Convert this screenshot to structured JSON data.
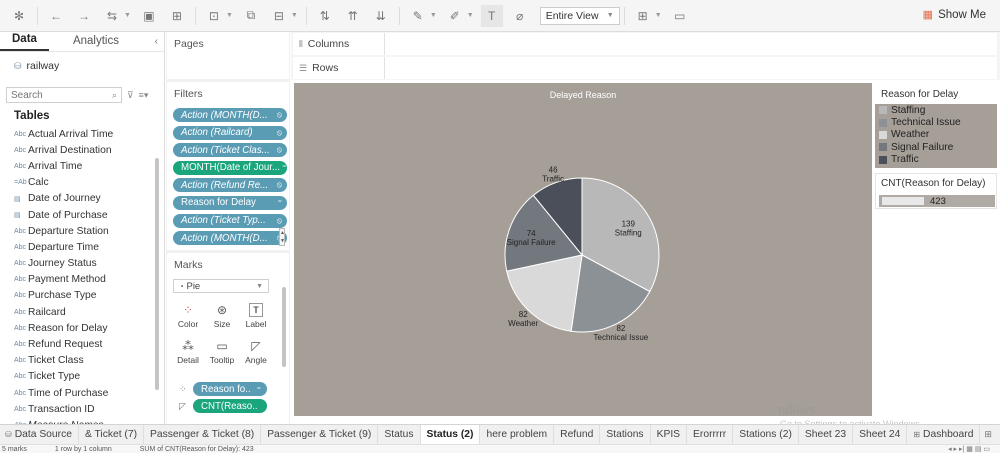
{
  "toolbar": {
    "fit_label": "Entire View",
    "show_me_label": "Show Me"
  },
  "data_pane": {
    "tabs": [
      "Data",
      "Analytics"
    ],
    "datasource": "railway",
    "search_placeholder": "Search",
    "tables_header": "Tables",
    "fields": [
      {
        "label": "Actual Arrival Time",
        "icon": "abc"
      },
      {
        "label": "Arrival Destination",
        "icon": "abc"
      },
      {
        "label": "Arrival Time",
        "icon": "abc"
      },
      {
        "label": "Calc",
        "icon": "=Abc"
      },
      {
        "label": "Date of Journey",
        "icon": "date"
      },
      {
        "label": "Date of Purchase",
        "icon": "date"
      },
      {
        "label": "Departure Station",
        "icon": "abc"
      },
      {
        "label": "Departure Time",
        "icon": "abc"
      },
      {
        "label": "Journey Status",
        "icon": "abc"
      },
      {
        "label": "Payment Method",
        "icon": "abc"
      },
      {
        "label": "Purchase Type",
        "icon": "abc"
      },
      {
        "label": "Railcard",
        "icon": "abc"
      },
      {
        "label": "Reason for Delay",
        "icon": "abc"
      },
      {
        "label": "Refund Request",
        "icon": "abc"
      },
      {
        "label": "Ticket Class",
        "icon": "abc"
      },
      {
        "label": "Ticket Type",
        "icon": "abc"
      },
      {
        "label": "Time of Purchase",
        "icon": "abc"
      },
      {
        "label": "Transaction ID",
        "icon": "abc"
      },
      {
        "label": "Measure Names",
        "icon": "abc"
      }
    ]
  },
  "pages_card": {
    "title": "Pages"
  },
  "filters_card": {
    "title": "Filters",
    "pills": [
      {
        "label": "Action (MONTH(D...",
        "color": "#5b9cb5",
        "italic": true
      },
      {
        "label": "Action (Railcard)",
        "color": "#5b9cb5",
        "italic": true
      },
      {
        "label": "Action (Ticket Clas...",
        "color": "#5b9cb5",
        "italic": true
      },
      {
        "label": "MONTH(Date of Jour...",
        "color": "#1aa57c",
        "italic": false
      },
      {
        "label": "Action (Refund Re...",
        "color": "#5b9cb5",
        "italic": true
      },
      {
        "label": "Reason for Delay",
        "color": "#5b9cb5",
        "italic": false
      },
      {
        "label": "Action (Ticket Typ...",
        "color": "#5b9cb5",
        "italic": true
      },
      {
        "label": "Action (MONTH(D...",
        "color": "#5b9cb5",
        "italic": true
      }
    ]
  },
  "marks_card": {
    "title": "Marks",
    "mark_type": "Pie",
    "buttons": [
      "Color",
      "Size",
      "Label",
      "Detail",
      "Tooltip",
      "Angle"
    ],
    "pills": [
      {
        "label": "Reason fo..",
        "color": "#5b9cb5"
      },
      {
        "label": "CNT(Reaso..",
        "color": "#1aa57c"
      }
    ]
  },
  "shelves": {
    "columns_label": "Columns",
    "rows_label": "Rows"
  },
  "colors": {
    "viz_background": "#a69f98",
    "staffing": "#b8b8b8",
    "technical_issue": "#8c9196",
    "weather": "#d9d9d9",
    "signal_failure": "#73787e",
    "traffic": "#4a4f5a"
  },
  "chart_data": {
    "type": "pie",
    "title": "Delayed Reason",
    "slices": [
      {
        "label": "Staffing",
        "value": 139
      },
      {
        "label": "Technical Issue",
        "value": 82
      },
      {
        "label": "Weather",
        "value": 82
      },
      {
        "label": "Signal Failure",
        "value": 74
      },
      {
        "label": "Traffic",
        "value": 46
      }
    ]
  },
  "legends": {
    "color_title": "Reason for Delay",
    "color_items": [
      "Staffing",
      "Technical Issue",
      "Weather",
      "Signal Failure",
      "Traffic"
    ],
    "size_title": "CNT(Reason for Delay)",
    "size_value": "423"
  },
  "tabs": {
    "data_source": "Data Source",
    "sheets": [
      {
        "label": "& Ticket (7)",
        "active": false
      },
      {
        "label": "Passenger & Ticket (8)",
        "active": false
      },
      {
        "label": "Passenger & Ticket (9)",
        "active": false
      },
      {
        "label": "Status",
        "active": false
      },
      {
        "label": "Status (2)",
        "active": true
      },
      {
        "label": "here problem",
        "active": false
      },
      {
        "label": "Refund",
        "active": false
      },
      {
        "label": "Stations",
        "active": false
      },
      {
        "label": "KPIS",
        "active": false
      },
      {
        "label": "Erorrrrr",
        "active": false
      },
      {
        "label": "Stations (2)",
        "active": false
      },
      {
        "label": "Sheet 23",
        "active": false
      },
      {
        "label": "Sheet 24",
        "active": false
      },
      {
        "label": "Dashboard",
        "active": false
      }
    ]
  },
  "watermark": {
    "line1": "ndows",
    "line2": "Go to Settings to activate Windows."
  },
  "status_bar": {
    "marks": "5 marks",
    "rows": "1 row by 1 column",
    "sum": "SUM of CNT(Reason for Delay): 423"
  }
}
